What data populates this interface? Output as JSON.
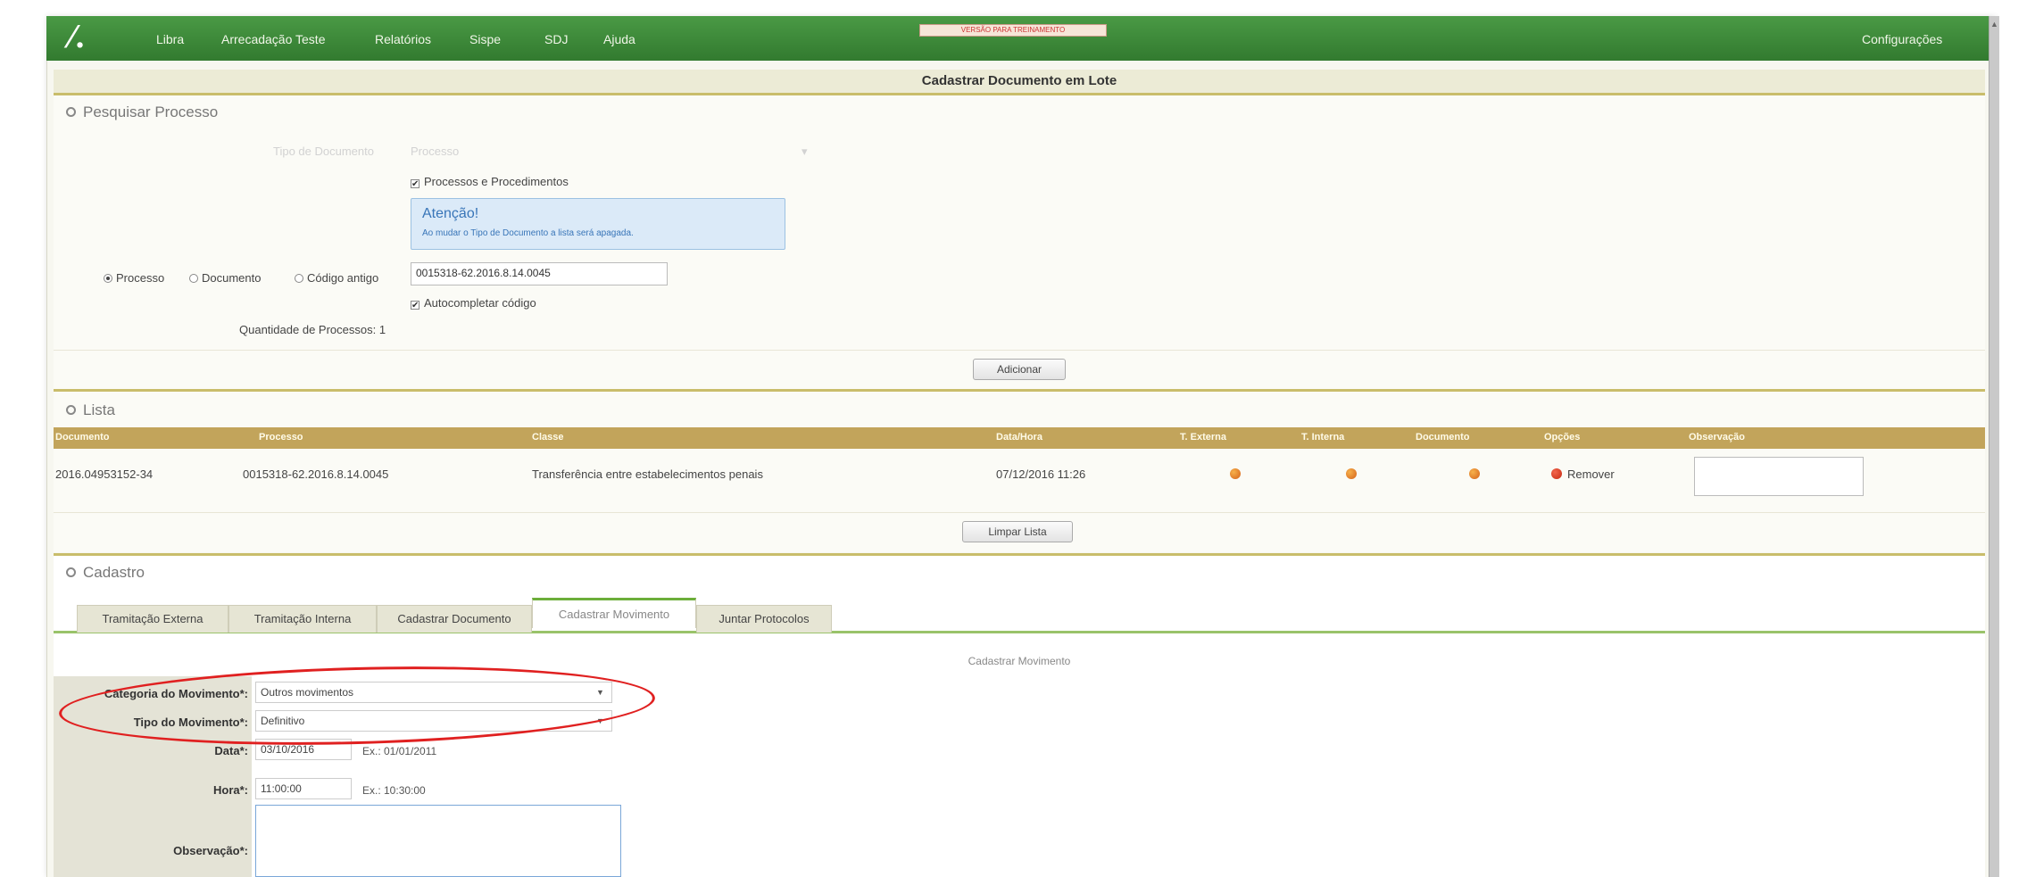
{
  "nav": {
    "logo": "⁄.",
    "items": [
      "Libra",
      "Arrecadação Teste",
      "Relatórios",
      "Sispe",
      "SDJ",
      "Ajuda"
    ],
    "training_badge": "VERSÃO PARA TREINAMENTO",
    "settings": "Configurações"
  },
  "page_title": "Cadastrar Documento em Lote",
  "search": {
    "title": "Pesquisar Processo",
    "faint_field_label": "Tipo de Documento",
    "faint_field_value": "Processo",
    "chk_processes_label": "Processos e Procedimentos",
    "alert_title": "Atenção!",
    "alert_text": "Ao mudar o Tipo de Documento a lista será apagada.",
    "radio_processo": "Processo",
    "radio_documento": "Documento",
    "radio_codigo": "Código antigo",
    "code_value": "0015318-62.2016.8.14.0045",
    "chk_autocomplete_label": "Autocompletar código",
    "count_label": "Quantidade de Processos: 1",
    "add_button": "Adicionar"
  },
  "list": {
    "title": "Lista",
    "headers": [
      "Documento",
      "Processo",
      "Classe",
      "Data/Hora",
      "T. Externa",
      "T. Interna",
      "Documento",
      "Opções",
      "Observação"
    ],
    "row": {
      "documento": "2016.04953152-34",
      "processo": "0015318-62.2016.8.14.0045",
      "classe": "Transferência entre estabelecimentos penais",
      "data_hora": "07/12/2016 11:26",
      "remove": "Remover"
    },
    "clear_button": "Limpar Lista"
  },
  "cadastro": {
    "title": "Cadastro",
    "tabs": [
      "Tramitação Externa",
      "Tramitação Interna",
      "Cadastrar Documento",
      "Cadastrar Movimento",
      "Juntar Protocolos"
    ],
    "active_tab": "Cadastrar Movimento",
    "subtitle": "Cadastrar Movimento",
    "fields": {
      "categoria_label": "Categoria do Movimento*:",
      "categoria_value": "Outros movimentos",
      "tipo_label": "Tipo do Movimento*:",
      "tipo_value": "Definitivo",
      "data_label": "Data*:",
      "data_value": "03/10/2016",
      "data_hint": "Ex.: 01/01/2011",
      "hora_label": "Hora*:",
      "hora_value": "11:00:00",
      "hora_hint": "Ex.: 10:30:00",
      "obs_label": "Observação*:"
    }
  },
  "colors": {
    "nav_green": "#3d8b3d",
    "table_header": "#c2a45b",
    "annotation_red": "#e02020",
    "tab_active_green": "#6cae3a"
  }
}
